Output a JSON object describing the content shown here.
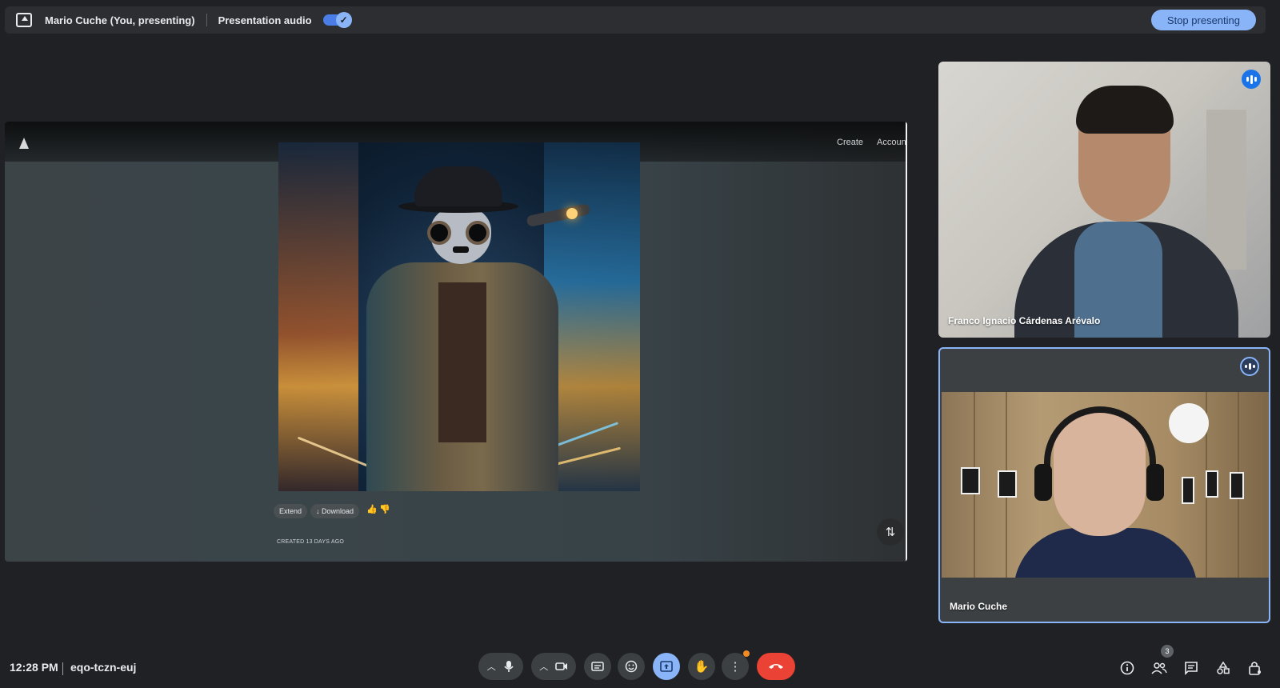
{
  "topbar": {
    "presenter": "Mario Cuche (You, presenting)",
    "audio_label": "Presentation audio",
    "audio_enabled": true,
    "stop_label": "Stop presenting"
  },
  "shared_screen": {
    "nav": {
      "create": "Create",
      "account": "Account"
    },
    "actions": {
      "extend": "Extend",
      "download": "↓ Download"
    },
    "created": "CREATED 13 DAYS AGO"
  },
  "participants": [
    {
      "name": "Franco Ignacio Cárdenas Arévalo",
      "speaking": true
    },
    {
      "name": "Mario Cuche",
      "speaking": true,
      "pinned_self": true
    }
  ],
  "bottombar": {
    "time": "12:28 PM",
    "meeting_code": "eqo-tczn-euj",
    "participant_count": "3"
  },
  "icons": {
    "present": "present-to-all-icon",
    "mic": "mic-icon",
    "camera": "videocam-icon",
    "captions": "captions-icon",
    "emoji": "emoji-icon",
    "raise_hand": "raise-hand-icon",
    "more": "more-vert-icon",
    "hangup": "call-end-icon",
    "info": "info-icon",
    "people": "people-icon",
    "chat": "chat-icon",
    "activities": "activities-icon",
    "host_controls": "lock-person-icon"
  },
  "colors": {
    "accent": "#8ab4f8",
    "hangup": "#ea4335",
    "background": "#202124"
  }
}
